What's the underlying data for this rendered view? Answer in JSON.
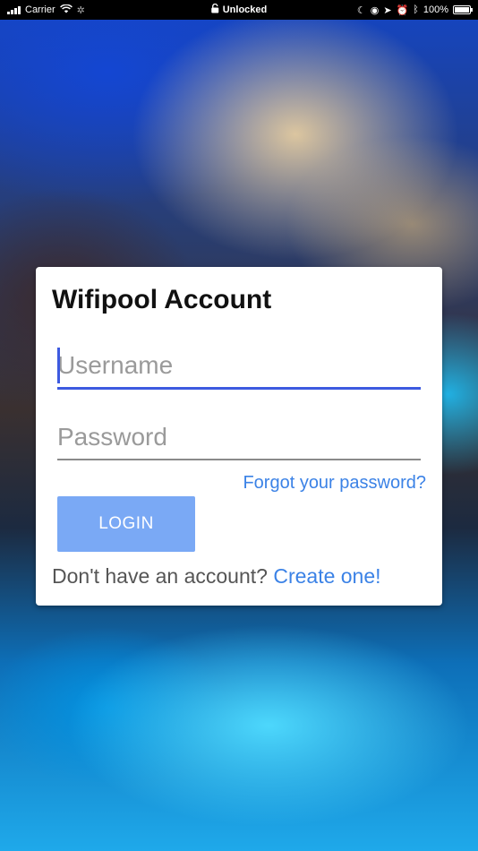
{
  "status_bar": {
    "carrier": "Carrier",
    "lock_label": "Unlocked",
    "battery": "100%"
  },
  "login_card": {
    "title": "Wifipool Account",
    "username_placeholder": "Username",
    "password_placeholder": "Password",
    "forgot_link": "Forgot your password?",
    "login_button": "LOGIN",
    "no_account_text": "Don't have an account?",
    "create_link": "Create one!"
  },
  "colors": {
    "accent": "#3d5ae0",
    "link": "#3b82e6",
    "button": "#7aa9f5"
  },
  "icons": [
    "signal-icon",
    "wifi-icon",
    "lock-icon",
    "moon-icon",
    "location-icon",
    "alarm-icon",
    "bluetooth-icon",
    "battery-icon"
  ]
}
